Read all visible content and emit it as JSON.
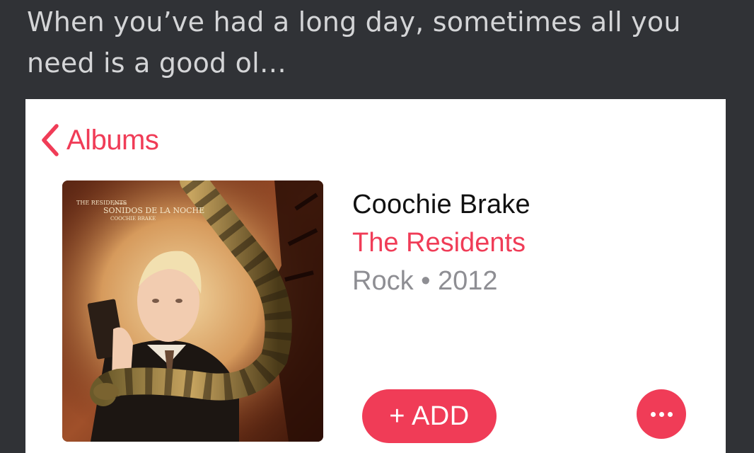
{
  "post": {
    "text": "When you’ve had a long day, sometimes all you need is a good ol…"
  },
  "nav": {
    "back_label": "Albums",
    "back_icon": "chevron-left-icon"
  },
  "album": {
    "title": "Coochie Brake",
    "artist": "The Residents",
    "genre_year": "Rock • 2012",
    "cover_text": {
      "band": "THE RESIDENTS",
      "presents": "present",
      "series": "SONIDOS DE LA NOCHE",
      "track": "COOCHIE BRAKE"
    }
  },
  "actions": {
    "add_label": "+ ADD",
    "more_icon": "more-horizontal-icon"
  },
  "colors": {
    "accent": "#f03c57",
    "background": "#303236",
    "card": "#ffffff",
    "secondary_text": "#8e8e93"
  }
}
